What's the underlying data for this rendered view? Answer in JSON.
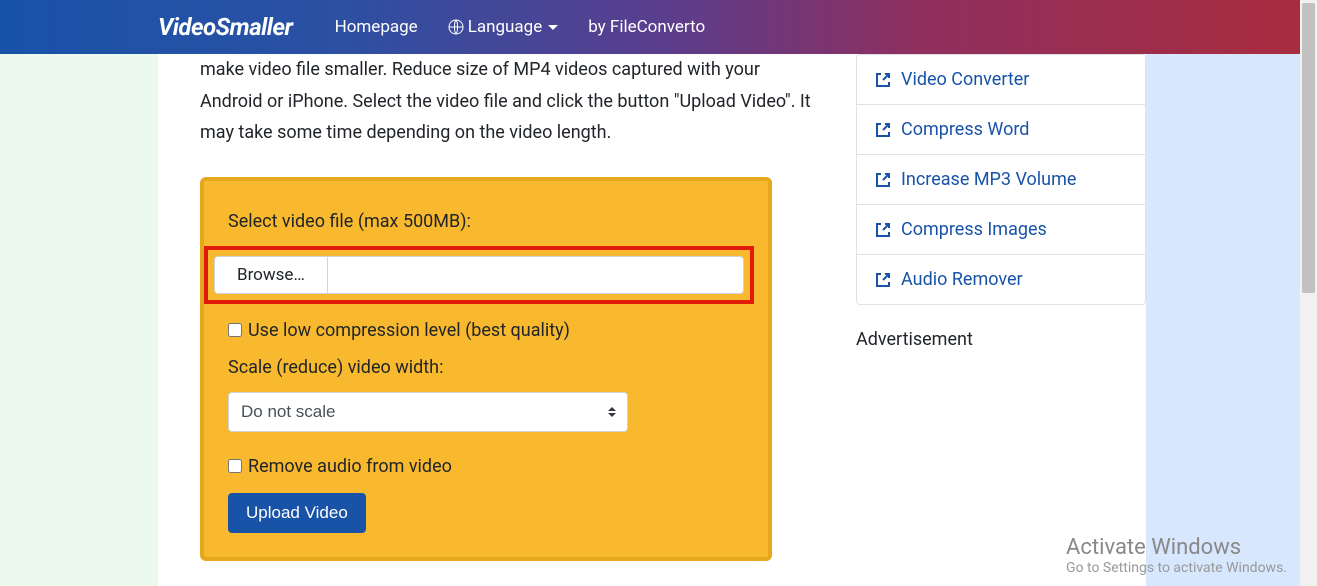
{
  "nav": {
    "brand": "VideoSmaller",
    "homepage": "Homepage",
    "language": "Language",
    "by": "by FileConverto"
  },
  "main": {
    "description": "make video file smaller. Reduce size of MP4 videos captured with your Android or iPhone. Select the video file and click the button \"Upload Video\". It may take some time depending on the video length.",
    "select_label": "Select video file (max 500MB):",
    "browse_label": "Browse…",
    "low_compression_label": "Use low compression level (best quality)",
    "scale_label": "Scale (reduce) video width:",
    "scale_value": "Do not scale",
    "remove_audio_label": "Remove audio from video",
    "upload_button": "Upload Video"
  },
  "sidebar": {
    "links": [
      "Video Converter",
      "Compress Word",
      "Increase MP3 Volume",
      "Compress Images",
      "Audio Remover"
    ],
    "advert": "Advertisement"
  },
  "watermark": {
    "line1": "Activate Windows",
    "line2": "Go to Settings to activate Windows."
  }
}
